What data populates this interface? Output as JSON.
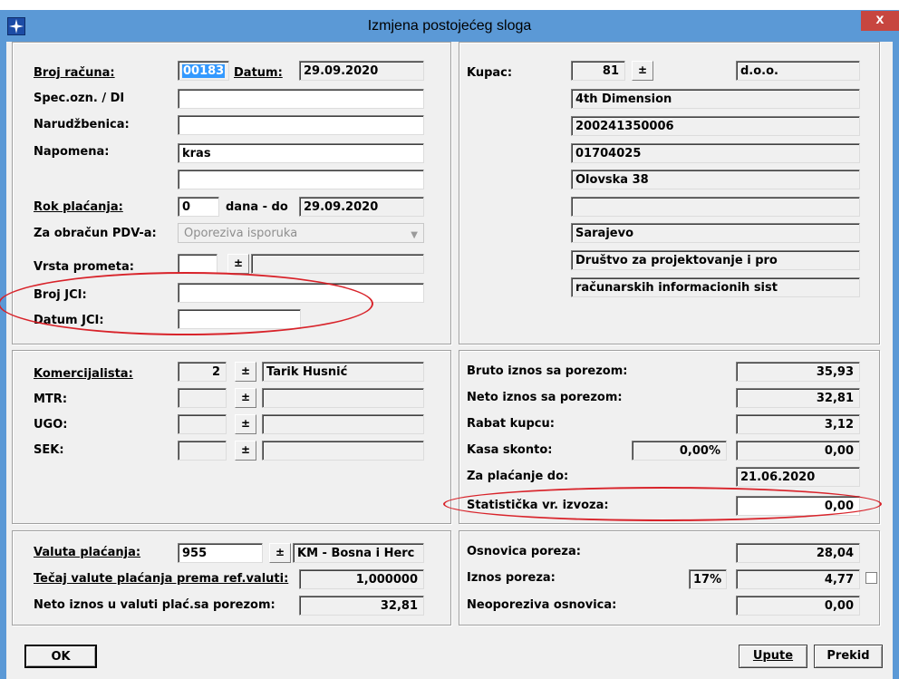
{
  "window": {
    "title": "Izmjena postojećeg sloga",
    "close_label": "x",
    "icon": "app-star-icon"
  },
  "invoice": {
    "broj_racuna_label": "Broj računa:",
    "broj_racuna_value": "00183",
    "datum_label": "Datum:",
    "datum_value": "29.09.2020",
    "spec_ozn_label": "Spec.ozn. / DI",
    "spec_ozn_value": "",
    "narudzbenica_label": "Narudžbenica:",
    "narudzbenica_value": "",
    "napomena_label": "Napomena:",
    "napomena_value": "kras",
    "napomena_value2": "",
    "rok_placanja_label": "Rok plaćanja:",
    "rok_placanja_value": "0",
    "dana_do_label": "dana - do",
    "rok_datum_value": "29.09.2020",
    "za_obracun_label": "Za obračun PDV-a:",
    "za_obracun_value": "Oporeziva isporuka",
    "vrsta_prometa_label": "Vrsta prometa:",
    "vrsta_prometa_value": "",
    "vrsta_prometa_desc": "",
    "broj_jci_label": "Broj JCI:",
    "broj_jci_value": "",
    "datum_jci_label": "Datum JCI:",
    "datum_jci_value": ""
  },
  "kupac": {
    "label": "Kupac:",
    "code": "81",
    "type": "d.o.o.",
    "lines": [
      "4th Dimension",
      "200241350006",
      "01704025",
      "Olovska 38",
      "",
      "Sarajevo",
      "Društvo za projektovanje i pro",
      "računarskih informacionih sist"
    ]
  },
  "komercijalista": {
    "rows": [
      {
        "label": "Komercijalista:",
        "code": "2",
        "name": "Tarik Husnić"
      },
      {
        "label": "MTR:",
        "code": "",
        "name": ""
      },
      {
        "label": "UGO:",
        "code": "",
        "name": ""
      },
      {
        "label": "SEK:",
        "code": "",
        "name": ""
      }
    ]
  },
  "totals": {
    "bruto_label": "Bruto iznos sa porezom:",
    "bruto_value": "35,93",
    "neto_label": "Neto iznos sa porezom:",
    "neto_value": "32,81",
    "rabat_label": "Rabat kupcu:",
    "rabat_value": "3,12",
    "kasa_label": "Kasa skonto:",
    "kasa_pct": "0,00%",
    "kasa_value": "0,00",
    "za_placanje_label": "Za plaćanje do:",
    "za_placanje_value": "21.06.2020",
    "statisticka_label": "Statistička vr. izvoza:",
    "statisticka_value": "0,00"
  },
  "valuta": {
    "valuta_label": "Valuta plaćanja:",
    "valuta_code": "955",
    "valuta_name": "KM - Bosna i Herc",
    "tecaj_label": "Tečaj valute plaćanja prema ref.valuti:",
    "tecaj_value": "1,000000",
    "neto_valuta_label": "Neto iznos u valuti plać.sa porezom:",
    "neto_valuta_value": "32,81"
  },
  "porez": {
    "osnovica_label": "Osnovica poreza:",
    "osnovica_value": "28,04",
    "iznos_label": "Iznos poreza:",
    "iznos_pct": "17%",
    "iznos_value": "4,77",
    "neoporeziva_label": "Neoporeziva osnovica:",
    "neoporeziva_value": "0,00"
  },
  "buttons": {
    "ok": "OK",
    "upute": "Upute",
    "prekid": "Prekid"
  },
  "dropdown_glyph": "±"
}
